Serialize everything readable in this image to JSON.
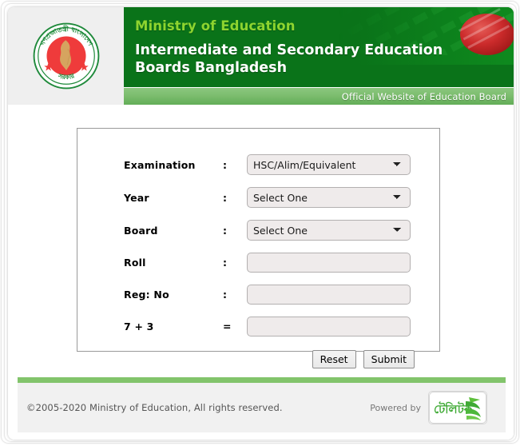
{
  "header": {
    "emblem_icon": "bangladesh-government-emblem",
    "ministry_line": "Ministry of Education",
    "board_title": "Intermediate and Secondary Education Boards Bangladesh",
    "official_note": "Official Website of Education Board",
    "colors": {
      "dark_green": "#0a7319",
      "light_green_text": "#8dd42f",
      "bar_green": "#7cbd6e",
      "emblem_panel": "#efefef",
      "flag_red": "#d6262c"
    }
  },
  "form": {
    "rows": [
      {
        "label": "Examination",
        "separator": ":",
        "control": "select",
        "name": "examination",
        "value": "HSC/Alim/Equivalent",
        "options": [
          "HSC/Alim/Equivalent"
        ]
      },
      {
        "label": "Year",
        "separator": ":",
        "control": "select",
        "name": "year",
        "value": "Select One",
        "options": [
          "Select One"
        ]
      },
      {
        "label": "Board",
        "separator": ":",
        "control": "select",
        "name": "board",
        "value": "Select One",
        "options": [
          "Select One"
        ]
      },
      {
        "label": "Roll",
        "separator": ":",
        "control": "text",
        "name": "roll",
        "value": "",
        "placeholder": ""
      },
      {
        "label": "Reg: No",
        "separator": ":",
        "control": "text",
        "name": "registration",
        "value": "",
        "placeholder": ""
      },
      {
        "label": "7 + 3",
        "separator": "=",
        "control": "text",
        "name": "captcha-answer",
        "value": "",
        "placeholder": ""
      }
    ],
    "buttons": {
      "reset_label": "Reset",
      "submit_label": "Submit"
    }
  },
  "footer": {
    "copyright": "©2005-2020 Ministry of Education, All rights reserved.",
    "powered_by_label": "Powered by",
    "logo_name": "teletalk-logo",
    "logo_text_bn": "টেলিটক",
    "logo_green": "#3faa35",
    "rule_green": "#82c46b"
  }
}
